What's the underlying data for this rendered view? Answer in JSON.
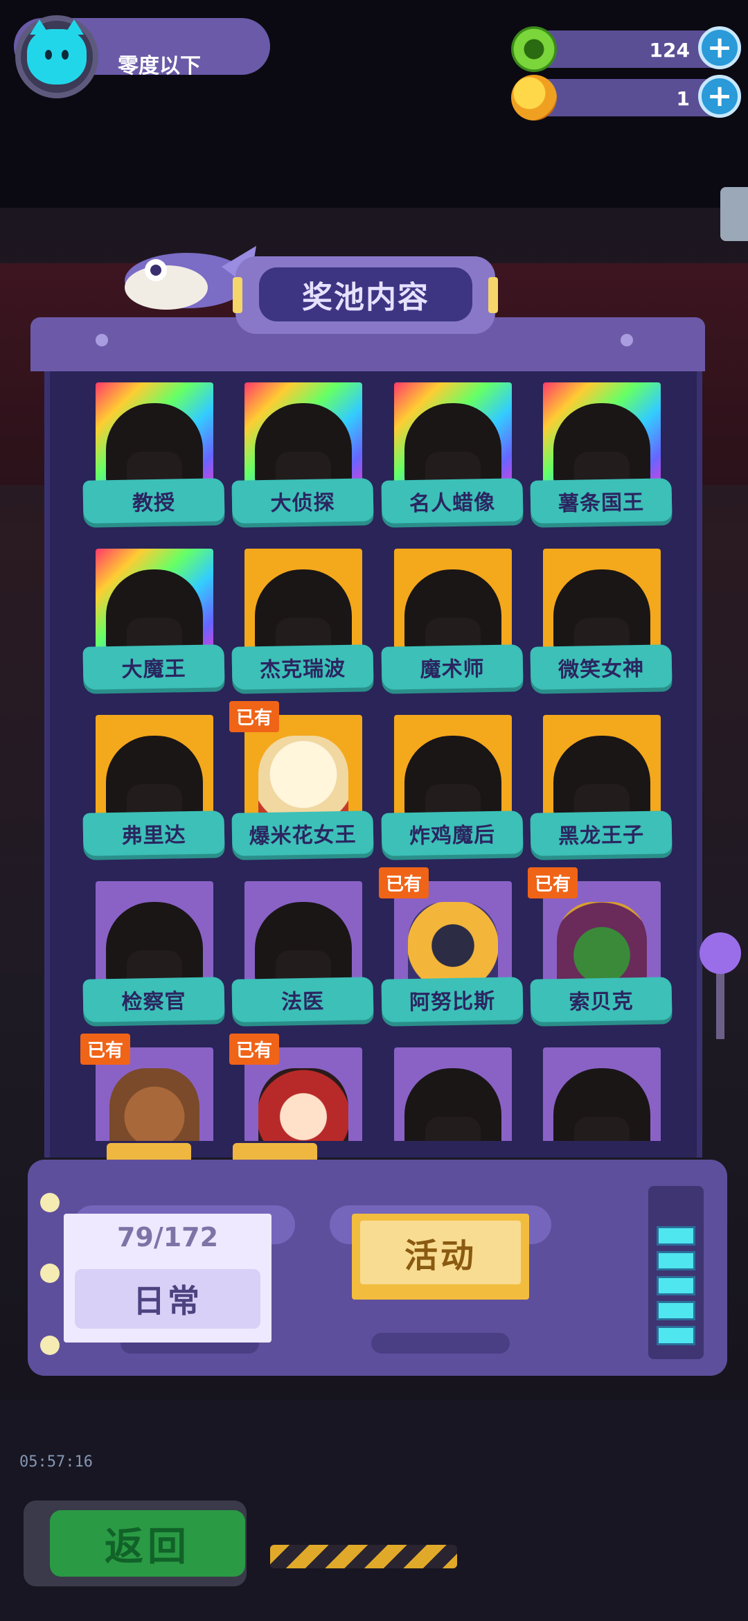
{
  "profile": {
    "name": "零度以下"
  },
  "currencies": [
    {
      "icon": "green-coin-icon",
      "value": "124"
    },
    {
      "icon": "planet-token-icon",
      "value": "1"
    }
  ],
  "header": {
    "title": "奖池内容"
  },
  "pool": {
    "owned_badge": "已有",
    "cards": [
      {
        "name": "教授",
        "frame": "rainbow",
        "owned": false
      },
      {
        "name": "大侦探",
        "frame": "rainbow",
        "owned": false
      },
      {
        "name": "名人蜡像",
        "frame": "rainbow",
        "owned": false
      },
      {
        "name": "薯条国王",
        "frame": "rainbow",
        "owned": false
      },
      {
        "name": "大魔王",
        "frame": "rainbow",
        "owned": false
      },
      {
        "name": "杰克瑞波",
        "frame": "gold",
        "owned": false
      },
      {
        "name": "魔术师",
        "frame": "gold",
        "owned": false
      },
      {
        "name": "微笑女神",
        "frame": "gold",
        "owned": false
      },
      {
        "name": "弗里达",
        "frame": "gold",
        "owned": false
      },
      {
        "name": "爆米花女王",
        "frame": "gold",
        "owned": true
      },
      {
        "name": "炸鸡魔后",
        "frame": "gold",
        "owned": false
      },
      {
        "name": "黑龙王子",
        "frame": "gold",
        "owned": false
      },
      {
        "name": "检察官",
        "frame": "purple",
        "owned": false
      },
      {
        "name": "法医",
        "frame": "purple",
        "owned": false
      },
      {
        "name": "阿努比斯",
        "frame": "purple",
        "owned": true
      },
      {
        "name": "索贝克",
        "frame": "purple",
        "owned": true
      },
      {
        "name": "",
        "frame": "purple",
        "owned": true
      },
      {
        "name": "",
        "frame": "purple",
        "owned": true
      },
      {
        "name": "",
        "frame": "purple",
        "owned": false
      },
      {
        "name": "",
        "frame": "purple",
        "owned": false
      }
    ]
  },
  "controls": {
    "progress": "79/172",
    "daily_label": "日常",
    "activity_label": "活动"
  },
  "back_label": "返回",
  "colors": {
    "rainbow": "#ff3a6a",
    "gold": "#f4a81c",
    "purple": "#8a62c6",
    "label": "#3cc0b8",
    "badge": "#f06418"
  }
}
